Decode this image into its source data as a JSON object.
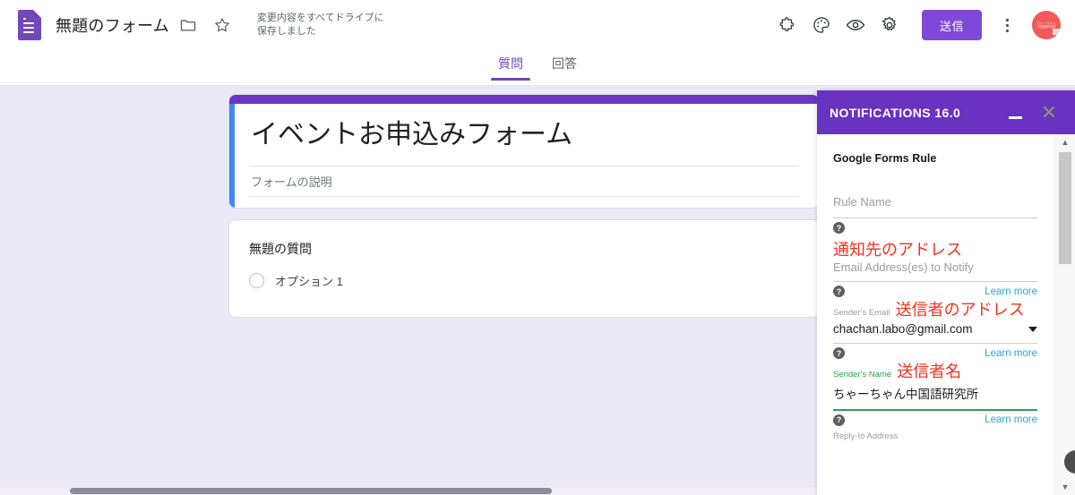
{
  "app": {
    "doc_title": "無題のフォーム",
    "save_status_line1": "変更内容をすべてドライブに",
    "save_status_line2": "保存しました",
    "send_label": "送信",
    "avatar_line1": "ちゃーちゃん",
    "avatar_line2": "中国語研究所",
    "icons": {
      "folder": "folder-icon",
      "star": "star-icon",
      "addons": "puzzle-addons-icon",
      "theme": "palette-theme-icon",
      "preview": "eye-preview-icon",
      "settings": "gear-settings-icon",
      "more": "kebab-more-icon"
    },
    "accent_purple": "#7248b9",
    "panel_purple": "#6a32c0",
    "background": "#ece9f6"
  },
  "tabs": [
    {
      "label": "質問",
      "active": true
    },
    {
      "label": "回答",
      "active": false
    }
  ],
  "form": {
    "title": "イベントお申込みフォーム",
    "description_placeholder": "フォームの説明",
    "question": {
      "title": "無題の質問",
      "option_1": "オプション 1"
    }
  },
  "panel": {
    "title": "NOTIFICATIONS 16.0",
    "minimize_label": "—",
    "close_label": "✕",
    "section_title": "Google Forms Rule",
    "fields": [
      {
        "id": "rule-name",
        "placeholder": "Rule Name",
        "value": "",
        "annotation": "",
        "learn_more": "",
        "underline_color": "#cfcfcf"
      },
      {
        "id": "email-addresses-to-notify",
        "placeholder": "Email Address(es) to Notify",
        "annotation": "通知先のアドレス",
        "learn_more": "Learn more",
        "underline_color": "#cfcfcf"
      },
      {
        "id": "senders-email",
        "label": "Sender's Email",
        "annotation": "送信者のアドレス",
        "value": "chachan.labo@gmail.com",
        "learn_more": "Learn more",
        "underline_color": "#cfcfcf",
        "has_dropdown": true
      },
      {
        "id": "senders-name",
        "label": "Sender's Name",
        "annotation": "送信者名",
        "value": "ちゃーちゃん中国語研究所",
        "learn_more": "Learn more",
        "underline_color": "#2f9e4f",
        "label_color": "#2f9e4f"
      },
      {
        "id": "reply-to-address",
        "label": "Reply-to Address",
        "annotation": "",
        "value": "",
        "learn_more": "",
        "underline_color": "#cfcfcf"
      }
    ],
    "help_icon": "?",
    "learn_more_label": "Learn more"
  }
}
